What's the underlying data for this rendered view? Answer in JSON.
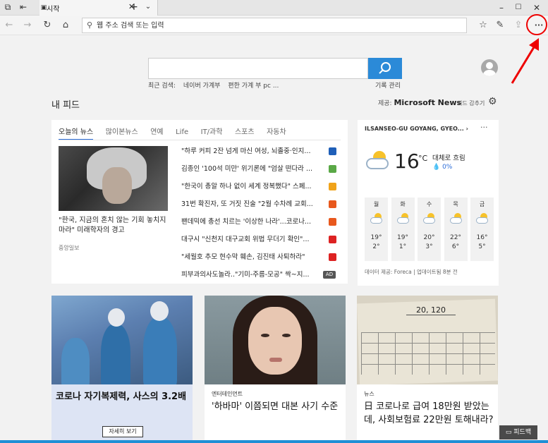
{
  "window": {
    "tab_title": "시작",
    "icons": [
      "tab-preview-icon",
      "tab-aside-icon",
      "page-icon",
      "close-icon",
      "new-tab-icon",
      "chevron-down-icon",
      "minimize-icon",
      "maximize-icon",
      "window-close-icon"
    ]
  },
  "toolbar": {
    "address_placeholder": "웹 주소 검색 또는 입력",
    "more_label": "···"
  },
  "search": {
    "recent_label": "최근 검색:",
    "recent_items": [
      "네이버 가계부",
      "편한 가계 부 pc ..."
    ],
    "history_label": "기록 관리"
  },
  "feed": {
    "title": "내 피드",
    "provider_prefix": "제공:",
    "provider_name": "Microsoft News",
    "hide_label": "피드 감추기",
    "tabs": [
      "오늘의 뉴스",
      "많이본뉴스",
      "연예",
      "Life",
      "IT/과학",
      "스포츠",
      "자동차"
    ],
    "hero_caption": "\"한국, 지금의 혼치 않는 기회 놓치지 마라\" 미래학자의 경고",
    "hero_source": "중앙일보",
    "items": [
      {
        "text": "\"하루 커피 2잔 넘게 마신 여성, 뇌졸중·인지...",
        "badge": "#1f5fb8"
      },
      {
        "text": "김종인 '100석 미만' 위기론에 \"엄살 떤다라 ...",
        "badge": "#5aa846"
      },
      {
        "text": "\"한국이 총알 하나 없이 세계 정복했다\" 스페...",
        "badge": "#f0a31a"
      },
      {
        "text": "31번 확진자, 또 거짓 진술 \"2월 수차례 교회...",
        "badge": "#e8581d"
      },
      {
        "text": "팬데믹에 총선 치르는 '이상한 나라'...코로나...",
        "badge": "#e8581d"
      },
      {
        "text": "대구시 \"신천지 대구교회 위법 무더기 확인\"...",
        "badge": "#d22"
      },
      {
        "text": "\"세월호 추모 현수막 훼손, 김진태 사퇴하라\"",
        "badge": "#d22"
      },
      {
        "text": "피부과의사도놀라..\"기미-주름-모공\" 싹~지...",
        "badge": "ad",
        "ad_label": "AD"
      }
    ]
  },
  "weather": {
    "location": "ILSANSEO-GU GOYANG, GYEO...",
    "chevron": "›",
    "more": "···",
    "temperature": "16",
    "unit": "°C",
    "condition": "대체로 흐림",
    "precip": "💧 0%",
    "days": [
      {
        "day": "월",
        "hi": "19°",
        "lo": "2°"
      },
      {
        "day": "화",
        "hi": "19°",
        "lo": "1°"
      },
      {
        "day": "수",
        "hi": "20°",
        "lo": "3°"
      },
      {
        "day": "목",
        "hi": "22°",
        "lo": "6°"
      },
      {
        "day": "금",
        "hi": "16°",
        "lo": "5°"
      }
    ],
    "provider": "데이터 제공: Foreca | 업데이트됨 8분 전"
  },
  "cards": [
    {
      "title": "코로나 자기복제력, 사스의 3.2배",
      "button": "자세히 보기"
    },
    {
      "category": "엔터테인먼트",
      "title": "'하바마' 이쯤되면 대본 사기 수준"
    },
    {
      "category": "뉴스",
      "title": "日 코로나로 급여 18만원 받았는데, 사회보험료 22만원 토해내라?",
      "image_amount": "20, 120"
    }
  ],
  "feedback_label": "피드백"
}
